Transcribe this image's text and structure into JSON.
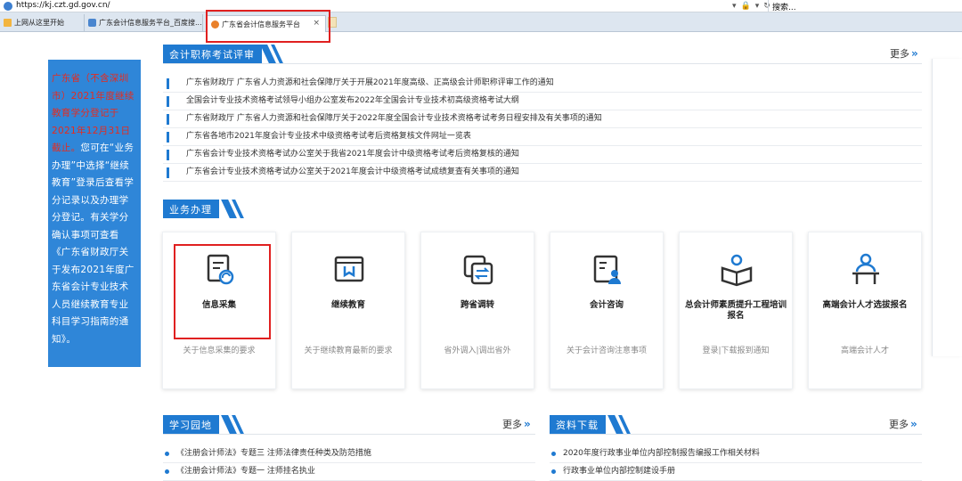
{
  "browser": {
    "url": "https://kj.czt.gd.gov.cn/",
    "search_placeholder": "搜索...",
    "tabs": [
      {
        "label": "上网从这里开始"
      },
      {
        "label": "广东会计信息服务平台_百度搜..."
      },
      {
        "label": "广东省会计信息服务平台",
        "active": true,
        "close": "×"
      }
    ]
  },
  "notice": {
    "red": "广东省（不含深圳市）2021年度继续教育学分登记于2021年12月31日截止。",
    "white": "您可在“业务办理”中选择“继续教育”登录后查看学分记录以及办理学分登记。有关学分确认事项可查看《广东省财政厅关于发布2021年度广东省会计专业技术人员继续教育专业科目学习指南的通知》。"
  },
  "sections": {
    "exam": {
      "title": "会计职称考试评审",
      "more": "更多",
      "items": [
        "广东省财政厅 广东省人力资源和社会保障厅关于开展2021年度高级、正高级会计师职称评审工作的通知",
        "全国会计专业技术资格考试领导小组办公室发布2022年全国会计专业技术初高级资格考试大纲",
        "广东省财政厅 广东省人力资源和社会保障厅关于2022年度全国会计专业技术资格考试考务日程安排及有关事项的通知",
        "广东省各地市2021年度会计专业技术中级资格考试考后资格复核文件网址一览表",
        "广东省会计专业技术资格考试办公室关于我省2021年度会计中级资格考试考后资格复核的通知",
        "广东省会计专业技术资格考试办公室关于2021年度会计中级资格考试成绩复查有关事项的通知"
      ]
    },
    "business": {
      "title": "业务办理",
      "cards": [
        {
          "icon": "info-collect-icon",
          "title": "信息采集",
          "desc": "关于信息采集的要求"
        },
        {
          "icon": "continuing-education-icon",
          "title": "继续教育",
          "desc": "关于继续教育最新的要求"
        },
        {
          "icon": "transfer-icon",
          "title": "跨省调转",
          "desc": "省外调入|调出省外"
        },
        {
          "icon": "consult-icon",
          "title": "会计咨询",
          "desc": "关于会计咨询注意事项"
        },
        {
          "icon": "training-icon",
          "title": "总会计师素质提升工程培训报名",
          "desc": "登录|下载报到通知"
        },
        {
          "icon": "talent-icon",
          "title": "高端会计人才选拔报名",
          "desc": "高端会计人才"
        }
      ]
    },
    "study": {
      "title": "学习园地",
      "more": "更多",
      "items": [
        "《注册会计师法》专题三 注师法律责任种类及防范措施",
        "《注册会计师法》专题一 注师挂名执业"
      ]
    },
    "download": {
      "title": "资料下载",
      "more": "更多",
      "items": [
        "2020年度行政事业单位内部控制报告编报工作相关材料",
        "行政事业单位内部控制建设手册"
      ]
    }
  },
  "colors": {
    "accent": "#1f7ad1",
    "notice_bg": "#2f86d8",
    "highlight": "#e02020",
    "notice_red": "#e62b1e"
  }
}
